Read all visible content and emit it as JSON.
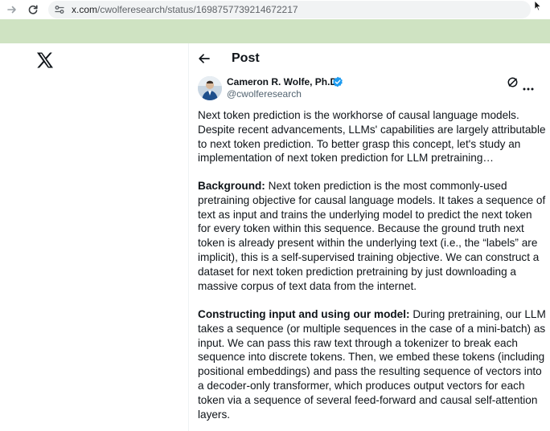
{
  "browser": {
    "url_host": "x.com",
    "url_path": "/cwolferesearch/status/1698757739214672217"
  },
  "post_header": {
    "title": "Post"
  },
  "author": {
    "name": "Cameron R. Wolfe, Ph.D.",
    "handle": "@cwolferesearch",
    "verified": true
  },
  "tweet": {
    "p1": [
      "Next token prediction is the workhorse of causal language models.",
      "Despite recent advancements, LLMs' capabilities are largely attributable",
      "to next token prediction. To better grasp this concept, let's study an",
      "implementation of next token prediction for LLM pretraining…"
    ],
    "p2_heading": "Background:",
    "p2": [
      " Next token prediction is the most commonly-used",
      "pretraining objective for causal language models. It takes a sequence of",
      "text as input and trains the underlying model to predict the next token",
      "for every token within this sequence. Because the ground truth next",
      "token is already present within the underlying text (i.e., the “labels” are",
      "implicit), this is a self-supervised training objective. We can construct a",
      "dataset for next token prediction pretraining by just downloading a",
      "massive corpus of text data from the internet."
    ],
    "p3_heading": "Constructing input and using our model:",
    "p3": [
      " During pretraining, our LLM",
      "takes a sequence (or multiple sequences in the case of a mini-batch) as",
      "input. We can pass this raw text through a tokenizer to break each",
      "sequence into discrete tokens. Then, we embed these tokens (including",
      "positional embeddings) and pass the resulting sequence of vectors into",
      "a decoder-only transformer, which produces output vectors for each",
      "token via a sequence of several feed-forward and causal self-attention",
      "layers."
    ]
  },
  "colors": {
    "green_band": "#cfe3c2",
    "verified": "#1d9bf0",
    "text": "#0f1419",
    "muted": "#536471"
  }
}
